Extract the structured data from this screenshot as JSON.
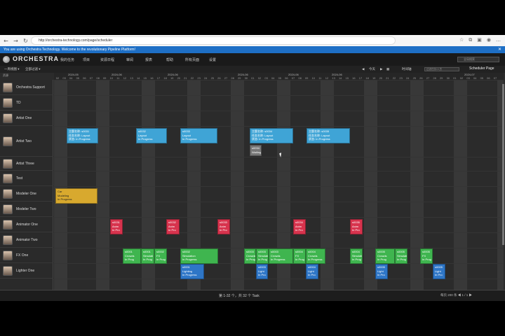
{
  "browser": {
    "url": "http://orchestra-technology.com/page/scheduler",
    "icons": [
      "back-icon",
      "forward-icon",
      "refresh-icon",
      "star-icon",
      "extension-icon",
      "profile-icon",
      "menu-icon"
    ]
  },
  "notice": {
    "text": "You are using Orchestra Technology. Welcome to the revolutionary Pipeline Platform!"
  },
  "header": {
    "logo": "ORCHESTRA",
    "menu": [
      "我的任务",
      "项目",
      "资源日程",
      "审阅",
      "报表",
      "帮助",
      "所有页面",
      "设置"
    ],
    "search_placeholder": "全局搜索"
  },
  "toolbar": {
    "view_label": "一周视图 ▾",
    "filter_label": "全部过滤 ▾",
    "today": "今天",
    "nav_prev": "◀",
    "nav_next": "▶",
    "grid_toggle": "▦",
    "schedule_label": "时间轴",
    "search_placeholder": "过滤任务/人员",
    "scheduler_page": "Scheduler Page"
  },
  "resources_label": "资源",
  "date_header": {
    "months": [
      "2024-05",
      "2024-06",
      "2024-06",
      "2024-06",
      "2024-06",
      "2024-06",
      "2024-07"
    ],
    "days": [
      "02",
      "03",
      "04",
      "05",
      "06",
      "07",
      "08",
      "09",
      "10",
      "11",
      "12",
      "13",
      "14",
      "15",
      "16",
      "17",
      "18",
      "19",
      "20",
      "21",
      "22",
      "23",
      "24",
      "25",
      "26",
      "27",
      "28",
      "29",
      "30",
      "01",
      "02",
      "03",
      "04",
      "05",
      "06",
      "07",
      "08",
      "09",
      "10",
      "11",
      "12",
      "13",
      "14",
      "15",
      "16",
      "17",
      "18",
      "19",
      "20",
      "21",
      "22",
      "23",
      "24",
      "25",
      "26",
      "27",
      "28",
      "29",
      "30",
      "01",
      "02",
      "03",
      "04",
      "05",
      "06",
      "07"
    ]
  },
  "resources": [
    {
      "name": "Orchestra Support"
    },
    {
      "name": "TD"
    },
    {
      "name": "Artist One"
    },
    {
      "name": "Artist Two"
    },
    {
      "name": "Artist Three"
    },
    {
      "name": "Test"
    },
    {
      "name": "Modeler One"
    },
    {
      "name": "Modeler Two"
    },
    {
      "name": "Animator One"
    },
    {
      "name": "Animator Two"
    },
    {
      "name": "FX One"
    },
    {
      "name": "Lighter One"
    }
  ],
  "events": [
    {
      "row": 3,
      "lines": [
        "主题名称: s0031",
        "任务名称: Layout",
        "状态: In Progress"
      ],
      "color": "blue"
    },
    {
      "row": 3,
      "lines": [
        "s0032",
        "Layout",
        "In Progress"
      ],
      "color": "blue"
    },
    {
      "row": 3,
      "lines": [
        "s0033",
        "Layout",
        "In Progress"
      ],
      "color": "blue"
    },
    {
      "row": 3,
      "lines": [
        "主题名称: s0034",
        "任务名称: Layout",
        "状态: In Progress"
      ],
      "color": "blue"
    },
    {
      "row": 3,
      "lines": [
        "主题名称: s0035",
        "任务名称: Layout",
        "状态: In Progress"
      ],
      "color": "blue"
    },
    {
      "row": 3,
      "lines": [
        "s0034",
        "Waiting"
      ],
      "color": "gray"
    },
    {
      "row": 6,
      "lines": [
        "Car",
        "Modeling",
        "In Progress"
      ],
      "color": "yellow"
    },
    {
      "row": 8,
      "lines": [
        "s0031",
        "Anim",
        "In Pro"
      ],
      "color": "red"
    },
    {
      "row": 8,
      "lines": [
        "s0032",
        "Anim",
        "In Pro"
      ],
      "color": "red"
    },
    {
      "row": 8,
      "lines": [
        "s0033",
        "Anim",
        "In Pro"
      ],
      "color": "red"
    },
    {
      "row": 8,
      "lines": [
        "s0034",
        "Anim",
        "In Pro"
      ],
      "color": "red"
    },
    {
      "row": 8,
      "lines": [
        "s0035",
        "Anim",
        "In Pro"
      ],
      "color": "red"
    },
    {
      "row": 10,
      "lines": [
        "s0001",
        "Crowds",
        "In Prog"
      ],
      "color": "green"
    },
    {
      "row": 10,
      "lines": [
        "s0001",
        "Simulati",
        "In Prog"
      ],
      "color": "green"
    },
    {
      "row": 10,
      "lines": [
        "s0002",
        "FX",
        "In Prog"
      ],
      "color": "green"
    },
    {
      "row": 10,
      "lines": [
        "s0002",
        "Simulation",
        "In Progress"
      ],
      "color": "green"
    },
    {
      "row": 10,
      "lines": [
        "s0003",
        "Crowds",
        "In Prog"
      ],
      "color": "green"
    },
    {
      "row": 10,
      "lines": [
        "s0003",
        "Simulati",
        "In Prog"
      ],
      "color": "green"
    },
    {
      "row": 10,
      "lines": [
        "s0003",
        "Crowds",
        "In Progress"
      ],
      "color": "green"
    },
    {
      "row": 10,
      "lines": [
        "s0004",
        "FX",
        "In Prog"
      ],
      "color": "green"
    },
    {
      "row": 10,
      "lines": [
        "s0004",
        "Crowds",
        "In Progress"
      ],
      "color": "green"
    },
    {
      "row": 10,
      "lines": [
        "s0004",
        "Simulati",
        "In Prog"
      ],
      "color": "green"
    },
    {
      "row": 10,
      "lines": [
        "s0005",
        "Crowds",
        "In Prog"
      ],
      "color": "green"
    },
    {
      "row": 10,
      "lines": [
        "s0005",
        "Simulati",
        "In Prog"
      ],
      "color": "green"
    },
    {
      "row": 10,
      "lines": [
        "s0005",
        "FX",
        "In Prog"
      ],
      "color": "green"
    },
    {
      "row": 11,
      "lines": [
        "s0001",
        "Lighting",
        "In Progress"
      ],
      "color": "darkblue"
    },
    {
      "row": 11,
      "lines": [
        "s0003",
        "Light",
        "In Pro"
      ],
      "color": "darkblue"
    },
    {
      "row": 11,
      "lines": [
        "s0004",
        "Light",
        "In Pro"
      ],
      "color": "darkblue"
    },
    {
      "row": 11,
      "lines": [
        "s0005",
        "Light",
        "In Pro"
      ],
      "color": "darkblue"
    },
    {
      "row": 11,
      "lines": [
        "s0005",
        "Light",
        "In Pro"
      ],
      "color": "darkblue"
    }
  ],
  "status": {
    "text": "第 1-32 个，共 32 个 Task",
    "pager": "每页 200 条   ◀  1 / 1  ▶"
  }
}
